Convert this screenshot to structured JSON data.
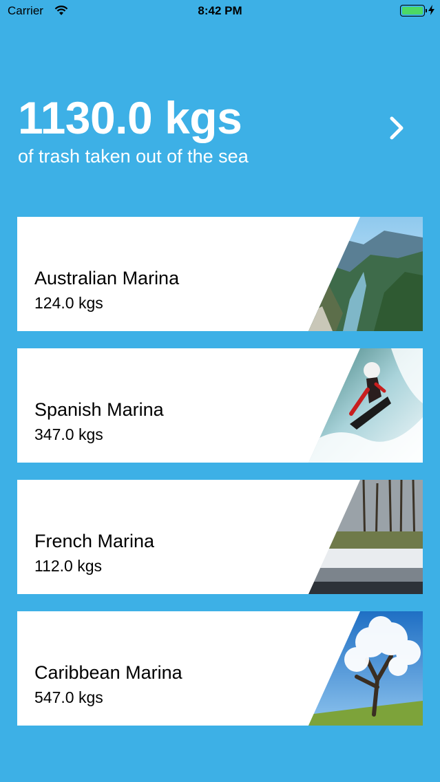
{
  "status_bar": {
    "carrier": "Carrier",
    "time": "8:42 PM",
    "battery_color": "#4CD964"
  },
  "summary": {
    "total": "1130.0 kgs",
    "caption": "of trash taken out of the sea",
    "next_icon": "chevron-right-icon"
  },
  "marinas": [
    {
      "name": "Australian Marina",
      "weight": "124.0 kgs",
      "photo": "mountain-valley-photo"
    },
    {
      "name": "Spanish Marina",
      "weight": "347.0 kgs",
      "photo": "whitewater-kayak-photo"
    },
    {
      "name": "French Marina",
      "weight": "112.0 kgs",
      "photo": "winter-park-photo"
    },
    {
      "name": "Caribbean Marina",
      "weight": "547.0 kgs",
      "photo": "blossom-tree-photo"
    }
  ],
  "colors": {
    "background": "#3DB0E6",
    "card": "#FFFFFF",
    "text_dark": "#000000"
  }
}
